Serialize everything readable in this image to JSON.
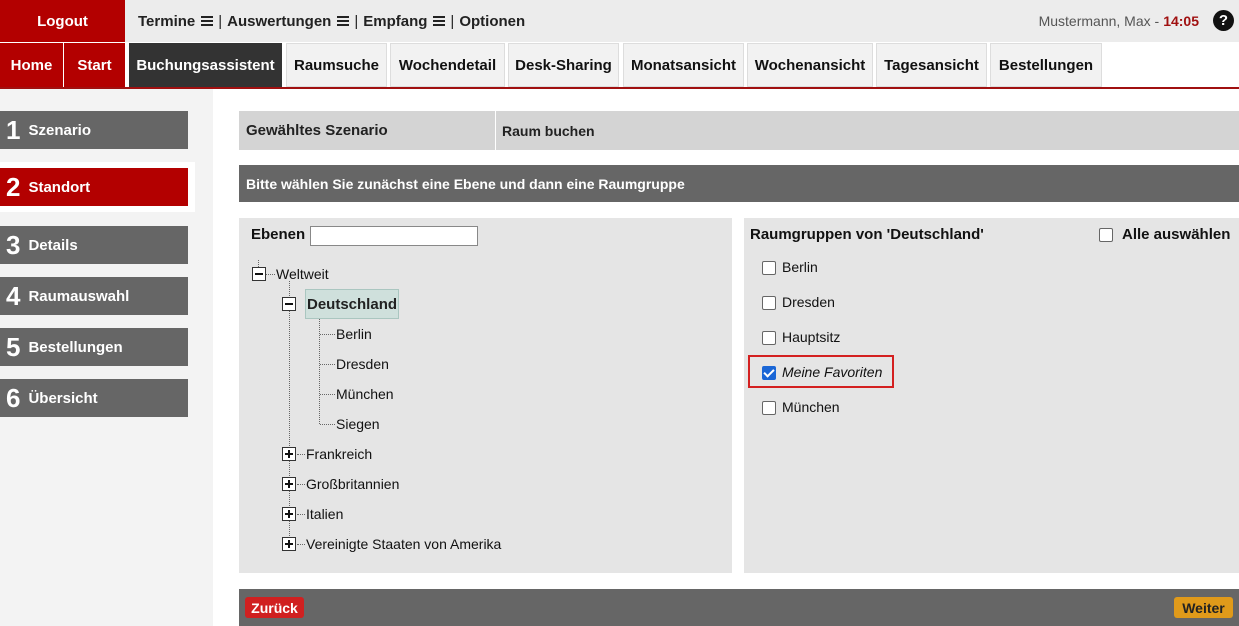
{
  "header": {
    "logout_label": "Logout",
    "menu": [
      {
        "label": "Termine",
        "has_menu": true
      },
      {
        "label": "Auswertungen",
        "has_menu": true
      },
      {
        "label": "Empfang",
        "has_menu": true
      },
      {
        "label": "Optionen",
        "has_menu": false
      }
    ],
    "user_name": "Mustermann, Max -",
    "time": "14:05",
    "help_symbol": "?"
  },
  "tabs": [
    {
      "label": "Home",
      "style": "red"
    },
    {
      "label": "Start",
      "style": "red"
    },
    {
      "label": "Buchungsassistent",
      "style": "dark"
    },
    {
      "label": "Raumsuche",
      "style": "light"
    },
    {
      "label": "Wochendetail",
      "style": "light"
    },
    {
      "label": "Desk-Sharing",
      "style": "light"
    },
    {
      "label": "Monatsansicht",
      "style": "light"
    },
    {
      "label": "Wochenansicht",
      "style": "light"
    },
    {
      "label": "Tagesansicht",
      "style": "light"
    },
    {
      "label": "Bestellungen",
      "style": "light"
    }
  ],
  "steps": [
    {
      "num": "1",
      "label": "Szenario",
      "active": false
    },
    {
      "num": "2",
      "label": "Standort",
      "active": true
    },
    {
      "num": "3",
      "label": "Details",
      "active": false
    },
    {
      "num": "4",
      "label": "Raumauswahl",
      "active": false
    },
    {
      "num": "5",
      "label": "Bestellungen",
      "active": false
    },
    {
      "num": "6",
      "label": "Übersicht",
      "active": false
    }
  ],
  "scenario": {
    "label": "Gewähltes Szenario",
    "value": "Raum buchen"
  },
  "instruction": "Bitte wählen Sie zunächst eine Ebene und dann eine Raumgruppe",
  "ebenen": {
    "label": "Ebenen",
    "input_value": "",
    "root": "Weltweit",
    "selected": "Deutschland",
    "children_selected": [
      "Berlin",
      "Dresden",
      "München",
      "Siegen"
    ],
    "others": [
      "Frankreich",
      "Großbritannien",
      "Italien",
      "Vereinigte Staaten von Amerika"
    ]
  },
  "raumgruppen": {
    "title": "Raumgruppen von 'Deutschland'",
    "select_all": "Alle auswählen",
    "items": [
      {
        "label": "Berlin",
        "checked": false
      },
      {
        "label": "Dresden",
        "checked": false
      },
      {
        "label": "Hauptsitz",
        "checked": false
      },
      {
        "label": "Meine Favoriten",
        "checked": true
      },
      {
        "label": "München",
        "checked": false
      }
    ]
  },
  "footer": {
    "back_label": "Zurück",
    "next_label": "Weiter"
  }
}
